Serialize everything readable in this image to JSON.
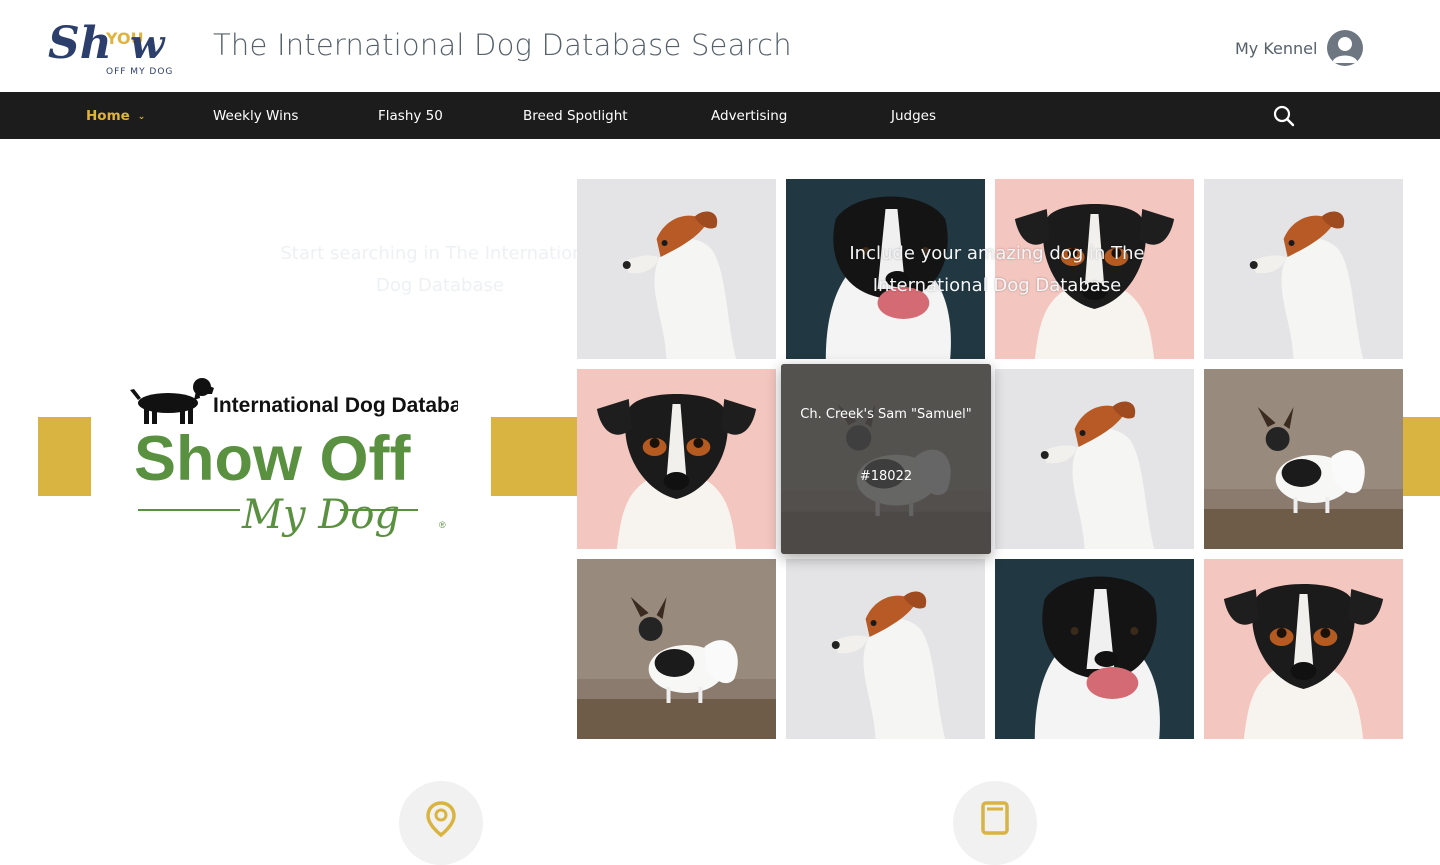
{
  "header": {
    "logo_text": "Show YOU OFF MY DOG",
    "site_title": "The International Dog Database Search",
    "kennel_label": "My Kennel",
    "avatar_icon": "user-avatar-icon"
  },
  "nav": {
    "items": [
      {
        "label": "Home",
        "active": true
      },
      {
        "label": "Weekly Wins"
      },
      {
        "label": "Flashy 50"
      },
      {
        "label": "Breed Spotlight"
      },
      {
        "label": "Advertising"
      },
      {
        "label": "Judges"
      }
    ],
    "search_icon": "search-icon"
  },
  "hero": {
    "logo_heading": "International Dog Database",
    "logo_title": "Show Off",
    "logo_sub": "My Dog",
    "left_text": "Start searching in The International Dog Database",
    "right_text": "Include your amazing dog in The International Dog Database",
    "hover_card": {
      "name": "Ch. Creek's Sam \"Samuel\"",
      "id": "#18022"
    }
  },
  "grid": {
    "tiles": [
      "jack-russell-white-brown",
      "border-collie",
      "jack-russell-tricolor",
      "jack-russell-white-brown",
      "jack-russell-tricolor",
      "papillon",
      "jack-russell-white-brown",
      "papillon",
      "papillon",
      "jack-russell-white-brown",
      "border-collie",
      "jack-russell-tricolor"
    ]
  },
  "colors": {
    "accent": "#d9b441",
    "nav_bg": "#1c1c1c",
    "logo_green": "#5a9140",
    "logo_navy": "#2c3e6b"
  }
}
